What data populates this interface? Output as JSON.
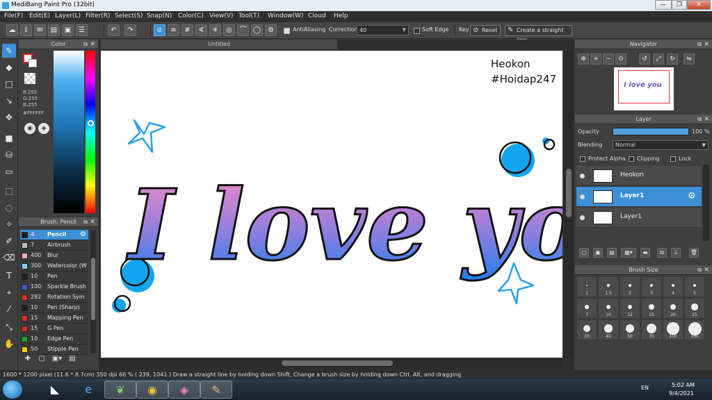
{
  "window": {
    "title": "MediBang Paint Pro (32bit)"
  },
  "menu": [
    "File(F)",
    "Edit(E)",
    "Layer(L)",
    "Filter(R)",
    "Select(S)",
    "Snap(N)",
    "Color(C)",
    "View(V)",
    "Tool(T)",
    "Window(W)",
    "Cloud",
    "Help"
  ],
  "toolbar": {
    "antialiasing_label": "AntiAliasing",
    "correction_label": "Correction",
    "correction_value": "40",
    "soft_edge_label": "Soft Edge",
    "key_label": "Key",
    "reset_label": "Reset",
    "straight_line_label": "Create a straight line"
  },
  "color_panel": {
    "title": "Color",
    "r": "R:255",
    "g": "G:255",
    "b": "B:255",
    "hex": "#FFFFFF",
    "foreground_color": "#ffffff",
    "accent_color": "#3d8fd6"
  },
  "brush_panel": {
    "title": "Brush: Pencil",
    "items": [
      {
        "size": "4",
        "name": "Pencil",
        "color": "#1f1f1f"
      },
      {
        "size": "7",
        "name": "Airbrush",
        "color": "#bdbdbd"
      },
      {
        "size": "400",
        "name": "Blur",
        "color": "#f3a6d0"
      },
      {
        "size": "300",
        "name": "Watercolor (W",
        "color": "#7fd0f5"
      },
      {
        "size": "10",
        "name": "Pen",
        "color": "#1f1f1f"
      },
      {
        "size": "100",
        "name": "Sparkle Brush",
        "color": "#3b5bd9"
      },
      {
        "size": "282",
        "name": "Rotation Sym",
        "color": "#e02929"
      },
      {
        "size": "10",
        "name": "Pen (Sharp)",
        "color": "#1f1f1f"
      },
      {
        "size": "15",
        "name": "Mapping Pen",
        "color": "#e02929"
      },
      {
        "size": "15",
        "name": "G Pen",
        "color": "#e02929"
      },
      {
        "size": "10",
        "name": "Edge Pen",
        "color": "#1fa81f"
      },
      {
        "size": "50",
        "name": "Stipple Pen",
        "color": "#f0d000"
      }
    ]
  },
  "canvas": {
    "tab_title": "Untitled",
    "watermark_line1": "Heokon",
    "watermark_line2": "#Hoidap247",
    "artwork_text": "I love you"
  },
  "navigator": {
    "title": "Navigator"
  },
  "layer_panel": {
    "title": "Layer",
    "opacity_label": "Opacity",
    "opacity_value": "100 %",
    "opacity_fraction": 1.0,
    "blending_label": "Blending",
    "blending_value": "Normal",
    "protect_alpha_label": "Protect Alpha",
    "clipping_label": "Clipping",
    "lock_label": "Lock",
    "layers": [
      {
        "name": "Heokon",
        "selected": false
      },
      {
        "name": "Layer1",
        "selected": true
      },
      {
        "name": "Layer1",
        "selected": false
      }
    ]
  },
  "brush_size": {
    "title": "Brush Size",
    "values": [
      "1",
      "1.5",
      "2",
      "3",
      "4",
      "5",
      "7",
      "10",
      "12",
      "15",
      "20",
      "25",
      "30",
      "40",
      "50",
      "70",
      "100",
      "150"
    ]
  },
  "status": {
    "text": "1600 * 1200 pixel   (11.6 * 8.7cm)   350 dpi   66 %   ( 239, 1041 )   Draw a straight line by holding down Shift, Change a brush size by holding down Ctrl, Alt, and dragging"
  },
  "taskbar": {
    "language": "EN",
    "time": "5:02 AM",
    "date": "9/4/2021"
  }
}
